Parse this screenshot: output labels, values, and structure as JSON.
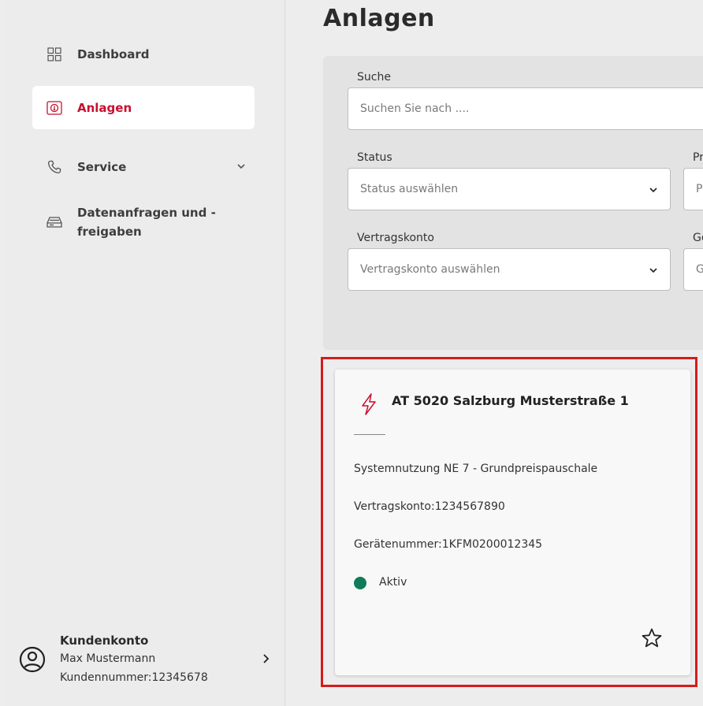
{
  "sidebar": {
    "items": [
      {
        "label": "Dashboard",
        "icon": "grid-icon"
      },
      {
        "label": "Anlagen",
        "icon": "meter-icon"
      },
      {
        "label": "Service",
        "icon": "phone-icon"
      },
      {
        "label_line1": "Datenanfragen und -",
        "label_line2": "freigaben",
        "icon": "drive-icon"
      }
    ],
    "account": {
      "title": "Kundenkonto",
      "name": "Max Mustermann",
      "number": "Kundennummer:12345678"
    }
  },
  "main": {
    "title": "Anlagen",
    "filters": {
      "search_label": "Suche",
      "search_placeholder": "Suchen Sie nach ....",
      "status_label": "Status",
      "status_placeholder": "Status auswählen",
      "account_label": "Vertragskonto",
      "account_placeholder": "Vertragskonto auswählen",
      "col2_label1": "Pr",
      "col2_placeholder1": "P",
      "col2_label2": "Ge",
      "col2_placeholder2": "G"
    },
    "card": {
      "title": "AT 5020 Salzburg Musterstraße 1",
      "product": "Systemnutzung NE 7 - Grundpreispauschale",
      "contract": "Vertragskonto:1234567890",
      "device": "Gerätenummer:1KFM0200012345",
      "status": "Aktiv"
    }
  },
  "colors": {
    "accent": "#c8102e",
    "status_active": "#0e7c5a",
    "highlight": "#d21d1d"
  }
}
